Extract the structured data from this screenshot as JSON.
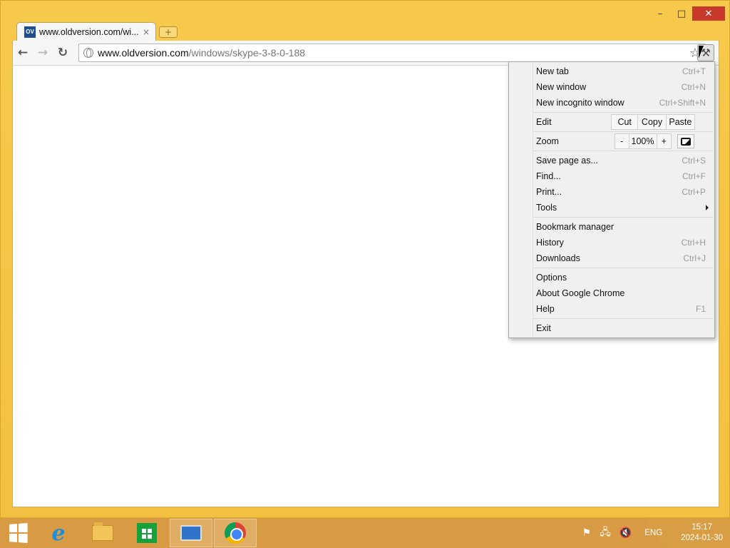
{
  "window": {
    "controls": {
      "minimize": "–",
      "maximize": "□",
      "close": "✕"
    }
  },
  "tab": {
    "favicon_text": "OV",
    "title": "www.oldversion.com/wi...",
    "close": "×",
    "newtab": "+"
  },
  "toolbar": {
    "back": "←",
    "forward": "→",
    "reload": "↻",
    "url_domain": "www.oldversion.com",
    "url_path": "/windows/skype-3-8-0-188",
    "star": "☆",
    "wrench": "🔧"
  },
  "menu": {
    "new_tab": {
      "label": "New tab",
      "shortcut": "Ctrl+T"
    },
    "new_window": {
      "label": "New window",
      "shortcut": "Ctrl+N"
    },
    "new_incognito": {
      "label": "New incognito window",
      "shortcut": "Ctrl+Shift+N"
    },
    "edit": {
      "label": "Edit",
      "cut": "Cut",
      "copy": "Copy",
      "paste": "Paste"
    },
    "zoom": {
      "label": "Zoom",
      "minus": "-",
      "value": "100%",
      "plus": "+"
    },
    "save_page": {
      "label": "Save page as...",
      "shortcut": "Ctrl+S"
    },
    "find": {
      "label": "Find...",
      "shortcut": "Ctrl+F"
    },
    "print": {
      "label": "Print...",
      "shortcut": "Ctrl+P"
    },
    "tools": {
      "label": "Tools"
    },
    "bookmark_manager": {
      "label": "Bookmark manager"
    },
    "history": {
      "label": "History",
      "shortcut": "Ctrl+H"
    },
    "downloads": {
      "label": "Downloads",
      "shortcut": "Ctrl+J"
    },
    "options": {
      "label": "Options"
    },
    "about": {
      "label": "About Google Chrome"
    },
    "help": {
      "label": "Help",
      "shortcut": "F1"
    },
    "exit": {
      "label": "Exit"
    }
  },
  "taskbar": {
    "apps": [
      "internet-explorer",
      "file-explorer",
      "store",
      "remote-desktop",
      "google-chrome"
    ],
    "lang": "ENG",
    "time": "15:17",
    "date": "2024-01-30"
  }
}
